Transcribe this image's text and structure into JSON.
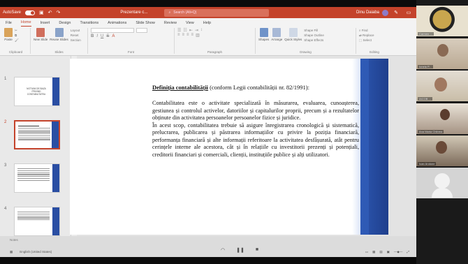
{
  "titlebar": {
    "autosave": "AutoSave",
    "toggle_state": "Off",
    "doc_title": "Prezentare c...",
    "search_placeholder": "Search (Alt+Q)",
    "user_name": "Dinu Daiaba"
  },
  "menu": [
    "File",
    "Home",
    "Insert",
    "Design",
    "Transitions",
    "Animations",
    "Slide Show",
    "Review",
    "View",
    "Help"
  ],
  "ribbon": {
    "clipboard": {
      "paste": "Paste",
      "label": "Clipboard"
    },
    "slides": {
      "new_slide": "New Slide",
      "reuse": "Reuse Slides",
      "layout": "Layout",
      "reset": "Reset",
      "section": "Section",
      "label": "Slides"
    },
    "font": {
      "label": "Font"
    },
    "paragraph": {
      "label": "Paragraph"
    },
    "drawing": {
      "shapes": "Shapes",
      "arrange": "Arrange",
      "quick_styles": "Quick Styles",
      "shape_fill": "Shape Fill",
      "shape_outline": "Shape Outline",
      "shape_effects": "Shape Effects",
      "label": "Drawing"
    },
    "editing": {
      "find": "Find",
      "replace": "Replace",
      "select": "Select",
      "label": "Editing"
    }
  },
  "thumbnails": [
    {
      "num": "1",
      "text": "NOTIUNI DE BAZA PRIVIND CONTABILITATEA"
    },
    {
      "num": "2",
      "text": ""
    },
    {
      "num": "3",
      "text": ""
    },
    {
      "num": "4",
      "text": ""
    }
  ],
  "slide": {
    "title_bold": "Definiția contabilității",
    "title_rest": " (conform Legii contabilității nr. 82/1991):",
    "p1": "Contabilitatea este o activitate specializată în măsurarea, evaluarea, cunoașterea, gestiunea și controlul activelor, datoriilor și capitalurilor proprii, precum și a rezultatelor obținute din activitatea persoanelor persoanelor fizice și juridice.",
    "p2": "În acest scop, contabilitatea trebuie să asigure înregistrarea cronologică și sistematică, prelucrarea, publicarea și păstrarea informațiilor cu privire la poziția financiară, performanța financiară și alte informații referitoare la activitatea desfășurată, atât pentru cerințele interne ale acestora, cât și în relațiile cu investitorii prezenți și potențiali, creditorii financiari și comerciali, clienții, instituțiile publice și alți utilizatori."
  },
  "statusbar": {
    "notes_hint": "Notes",
    "language": "English (United States)"
  },
  "participants": [
    {
      "name": "Carmen ..."
    },
    {
      "name": "Ionela P..."
    },
    {
      "name": "IACOB ..."
    },
    {
      "name": "Ana Maria Chibrea"
    },
    {
      "name": "Ioan Andone"
    },
    {
      "name": ""
    }
  ],
  "colors": {
    "accent": "#c4432b",
    "slide_blue": "#2a4ea3"
  }
}
